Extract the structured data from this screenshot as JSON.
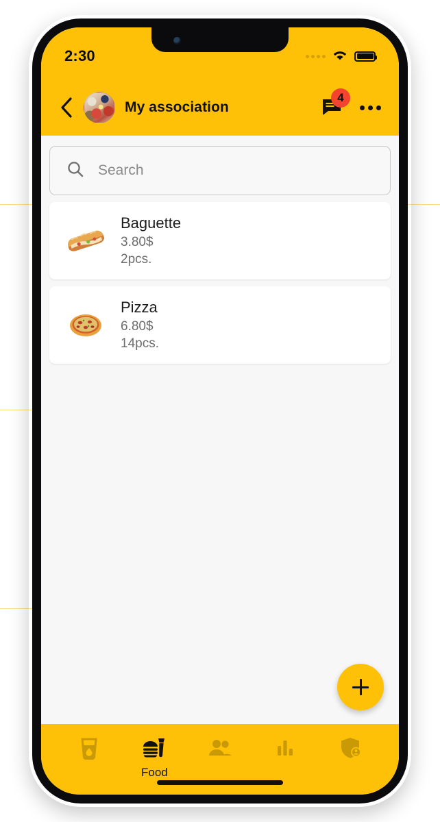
{
  "status_bar": {
    "time": "2:30",
    "signal_icon": "signal-dots-icon",
    "wifi_icon": "wifi-icon",
    "battery_icon": "battery-full-icon"
  },
  "header": {
    "back_icon": "chevron-left-icon",
    "avatar_icon": "group-avatar",
    "title": "My association",
    "messages_icon": "message-icon",
    "messages_badge": "4",
    "overflow_icon": "more-options-icon"
  },
  "search": {
    "icon": "search-icon",
    "placeholder": "Search",
    "value": ""
  },
  "list": {
    "items": [
      {
        "icon": "baguette-icon",
        "name": "Baguette",
        "price": "3.80$",
        "quantity": "2pcs."
      },
      {
        "icon": "pizza-icon",
        "name": "Pizza",
        "price": "6.80$",
        "quantity": "14pcs."
      }
    ]
  },
  "fab": {
    "icon": "plus-icon",
    "label": "+"
  },
  "bottom_nav": {
    "items": [
      {
        "icon": "drink-cup-icon",
        "label": "",
        "active": false
      },
      {
        "icon": "fast-food-icon",
        "label": "Food",
        "active": true
      },
      {
        "icon": "people-icon",
        "label": "",
        "active": false
      },
      {
        "icon": "bar-chart-icon",
        "label": "",
        "active": false
      },
      {
        "icon": "shield-person-icon",
        "label": "",
        "active": false
      }
    ]
  },
  "colors": {
    "brand_yellow": "#FFC107",
    "badge_red": "#F4432E",
    "inactive_nav": "#C99A06",
    "screen_bg": "#F7F7F7",
    "card_bg": "#FFFFFF"
  }
}
